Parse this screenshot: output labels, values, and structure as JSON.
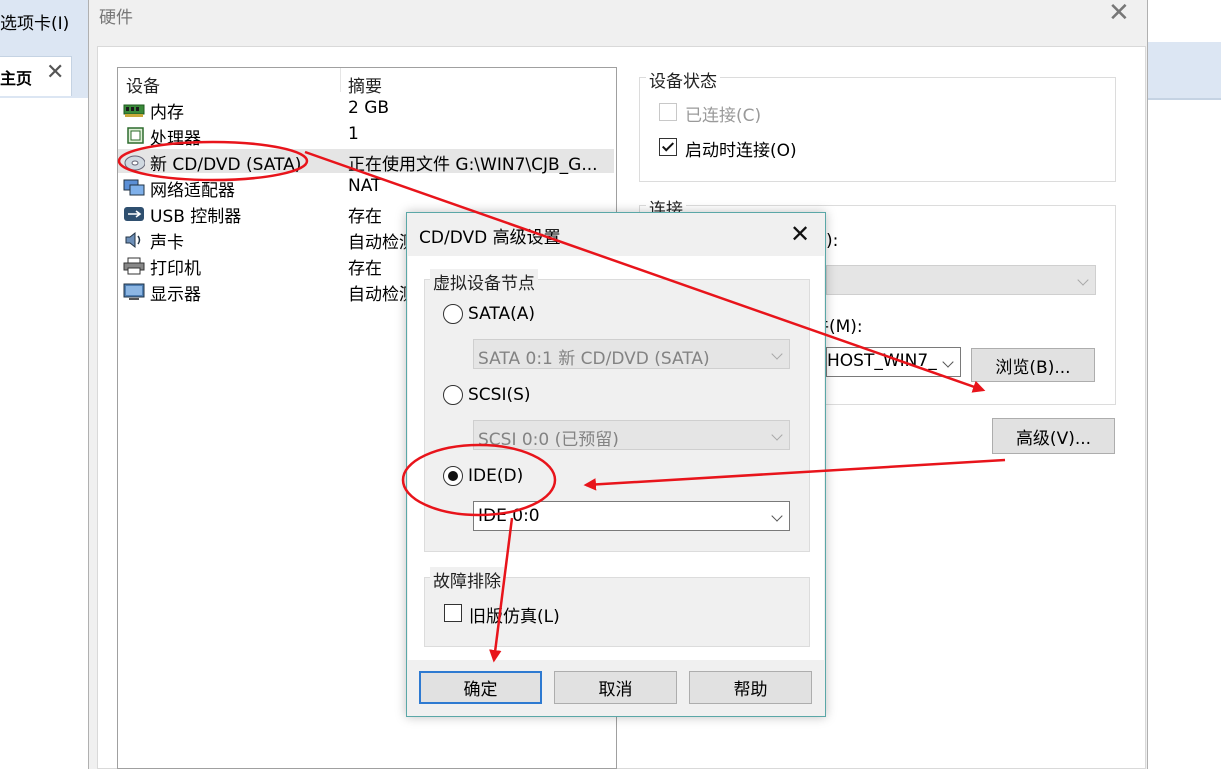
{
  "background_app": {
    "menu_label": "选项卡(I)",
    "tab_label": "主页",
    "tab_close": "✕"
  },
  "hardware": {
    "title": "硬件",
    "close": "✕",
    "columns": {
      "device": "设备",
      "summary": "摘要"
    },
    "devices": [
      {
        "name": "内存",
        "summary": "2 GB",
        "icon": "memory-icon"
      },
      {
        "name": "处理器",
        "summary": "1",
        "icon": "processor-icon"
      },
      {
        "name": "新 CD/DVD (SATA)",
        "summary": "正在使用文件 G:\\WIN7\\CJB_G...",
        "icon": "cd-dvd-icon"
      },
      {
        "name": "网络适配器",
        "summary": "NAT",
        "icon": "network-adapter-icon"
      },
      {
        "name": "USB 控制器",
        "summary": "存在",
        "icon": "usb-icon"
      },
      {
        "name": "声卡",
        "summary": "自动检测",
        "icon": "sound-card-icon"
      },
      {
        "name": "打印机",
        "summary": "存在",
        "icon": "printer-icon"
      },
      {
        "name": "显示器",
        "summary": "自动检测",
        "icon": "display-icon"
      }
    ],
    "device_status": {
      "title": "设备状态",
      "connected": {
        "label": "已连接(C)",
        "checked": false
      },
      "connect_at_power_on": {
        "label": "启动时连接(O)",
        "checked": true
      }
    },
    "connection": {
      "title": "连接",
      "partial_label_1": "):",
      "partial_label_2": "件(M):",
      "iso_path": "HOST_WIN7_",
      "browse_button": "浏览(B)...",
      "advanced_button": "高级(V)..."
    }
  },
  "advanced_dialog": {
    "title": "CD/DVD 高级设置",
    "close": "✕",
    "virtual_device_node": {
      "title": "虚拟设备节点",
      "options": [
        {
          "label": "SATA(A)",
          "selected": false,
          "select_value": "SATA 0:1    新 CD/DVD (SATA)"
        },
        {
          "label": "SCSI(S)",
          "selected": false,
          "select_value": "SCSI 0:0   (已预留)"
        },
        {
          "label": "IDE(D)",
          "selected": true,
          "select_value": "IDE 0:0"
        }
      ]
    },
    "troubleshooting": {
      "title": "故障排除",
      "legacy_emulation": {
        "label": "旧版仿真(L)",
        "checked": false
      }
    },
    "buttons": {
      "ok": "确定",
      "cancel": "取消",
      "help": "帮助"
    }
  },
  "colors": {
    "annotation_red": "#e8141b",
    "primary_button_border": "#2e7ad1",
    "selected_row": "#e5e5e5"
  }
}
